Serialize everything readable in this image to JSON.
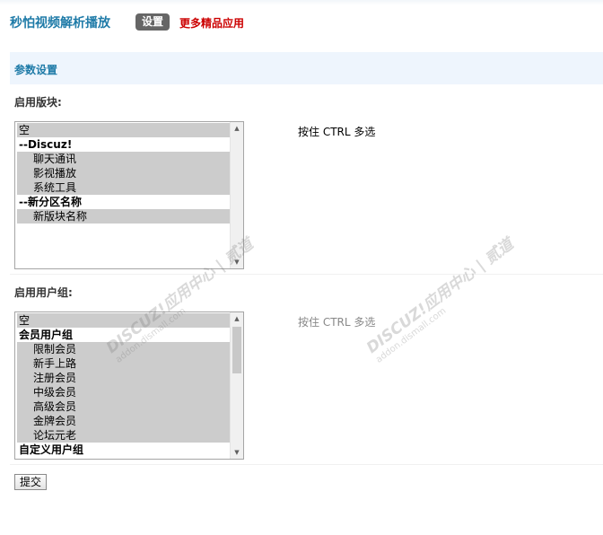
{
  "header": {
    "app_title": "秒怕视频解析播放",
    "settings_label": "设置",
    "more_apps_label": "更多精品应用"
  },
  "section": {
    "title": "参数设置"
  },
  "forums": {
    "label": "启用版块:",
    "hint": "按住 CTRL 多选",
    "options": [
      {
        "text": "空",
        "kind": "opt0",
        "selected": true
      },
      {
        "text": "--Discuz!",
        "kind": "group",
        "selected": false
      },
      {
        "text": "聊天通讯",
        "kind": "opt1",
        "selected": true
      },
      {
        "text": "影视播放",
        "kind": "opt1",
        "selected": true
      },
      {
        "text": "系统工具",
        "kind": "opt1",
        "selected": true
      },
      {
        "text": "--新分区名称",
        "kind": "group",
        "selected": false
      },
      {
        "text": "新版块名称",
        "kind": "opt1",
        "selected": true
      }
    ]
  },
  "usergroups": {
    "label": "启用用户组:",
    "hint": "按住 CTRL 多选",
    "options": [
      {
        "text": "空",
        "kind": "opt0",
        "selected": true
      },
      {
        "text": "会员用户组",
        "kind": "group",
        "selected": false
      },
      {
        "text": "限制会员",
        "kind": "opt1",
        "selected": true
      },
      {
        "text": "新手上路",
        "kind": "opt1",
        "selected": true
      },
      {
        "text": "注册会员",
        "kind": "opt1",
        "selected": true
      },
      {
        "text": "中级会员",
        "kind": "opt1",
        "selected": true
      },
      {
        "text": "高级会员",
        "kind": "opt1",
        "selected": true
      },
      {
        "text": "金牌会员",
        "kind": "opt1",
        "selected": true
      },
      {
        "text": "论坛元老",
        "kind": "opt1",
        "selected": true
      },
      {
        "text": "自定义用户组",
        "kind": "group",
        "selected": false
      }
    ]
  },
  "submit_label": "提交",
  "watermark": {
    "brand": "DISCUZ!应用中心 | 贰道",
    "url": "addon.dismall.com"
  }
}
